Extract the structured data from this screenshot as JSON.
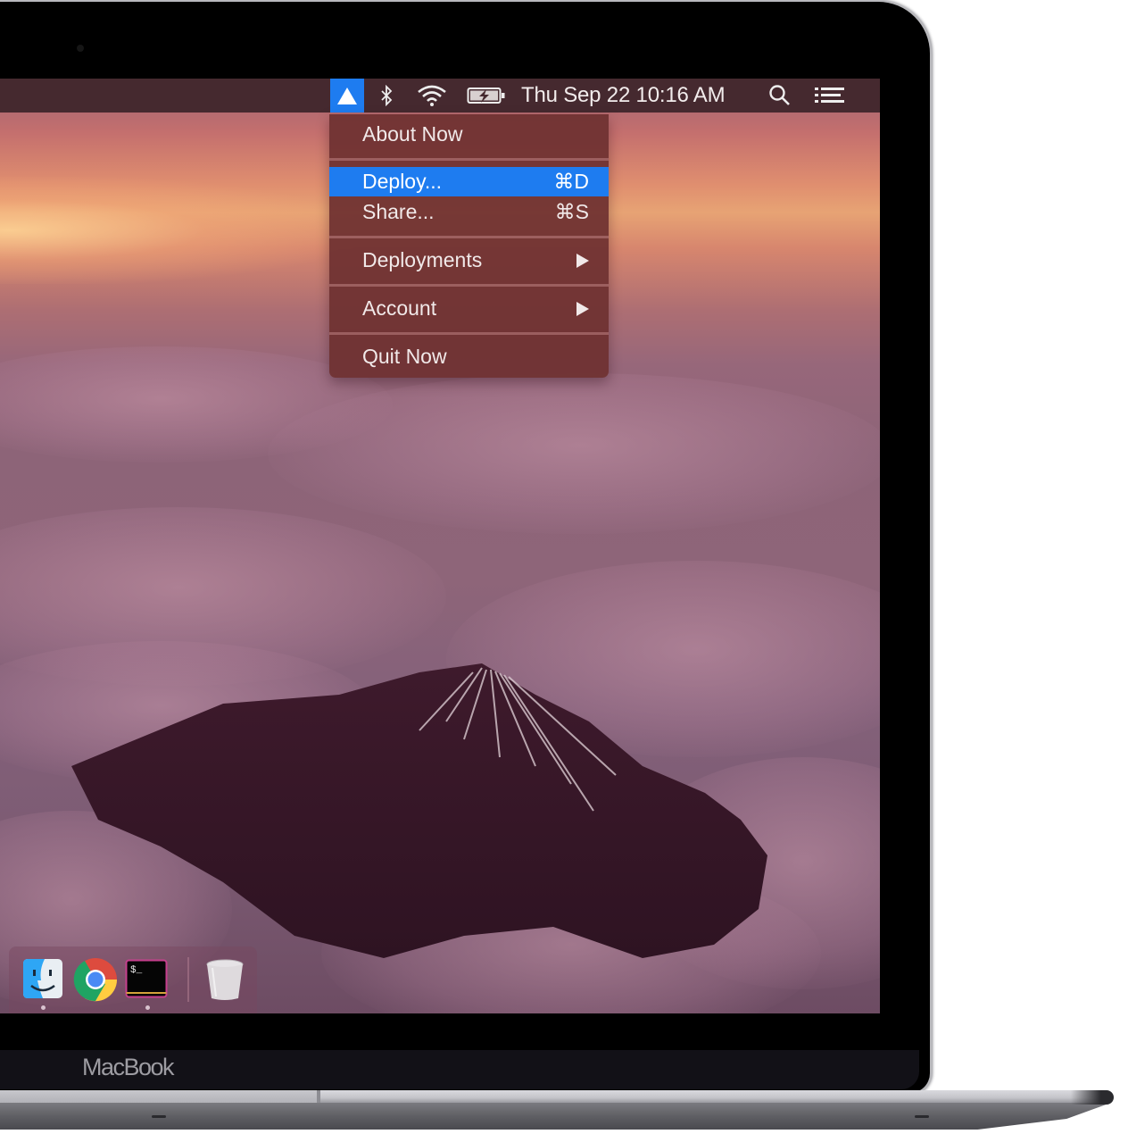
{
  "device": {
    "brand_label": "MacBook"
  },
  "menubar": {
    "app_icon": "now-triangle-icon",
    "status_icons": [
      "bluetooth-icon",
      "wifi-icon",
      "battery-charging-icon"
    ],
    "clock": "Thu Sep 22  10:16 AM",
    "right_icons": [
      "spotlight-search-icon",
      "notification-center-icon"
    ],
    "accent_color": "#1e7cf0",
    "background_color": "#45292f"
  },
  "menu": {
    "items": [
      {
        "label": "About Now",
        "shortcut": "",
        "submenu": false,
        "highlighted": false
      },
      {
        "label": "Deploy...",
        "shortcut": "⌘D",
        "submenu": false,
        "highlighted": true
      },
      {
        "label": "Share...",
        "shortcut": "⌘S",
        "submenu": false,
        "highlighted": false
      },
      {
        "label": "Deployments",
        "shortcut": "",
        "submenu": true,
        "highlighted": false
      },
      {
        "label": "Account",
        "shortcut": "",
        "submenu": true,
        "highlighted": false
      },
      {
        "label": "Quit Now",
        "shortcut": "",
        "submenu": false,
        "highlighted": false
      }
    ],
    "highlight_color": "#1e7cf0",
    "background_color": "#6e3030"
  },
  "dock": {
    "apps": [
      {
        "name": "Finder",
        "icon": "finder-icon",
        "running": true
      },
      {
        "name": "Google Chrome",
        "icon": "chrome-icon",
        "running": false
      },
      {
        "name": "Terminal",
        "icon": "terminal-icon",
        "running": true
      },
      {
        "name": "Trash",
        "icon": "trash-icon",
        "running": false
      }
    ]
  },
  "wallpaper": {
    "description": "Aerial view of a snow-streaked volcanic peak rising through pink sunset clouds"
  }
}
